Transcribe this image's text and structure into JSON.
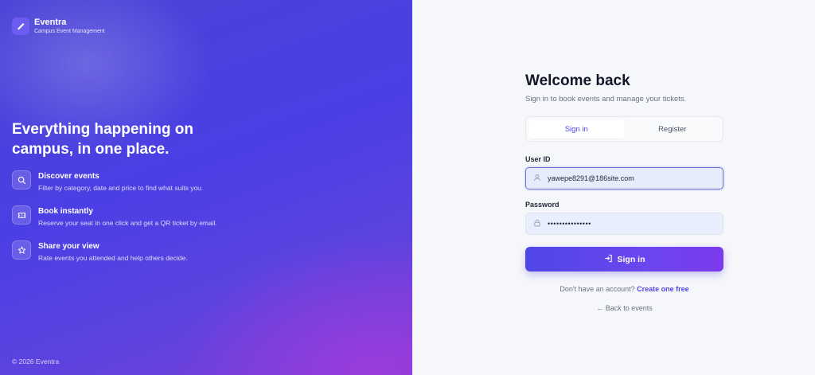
{
  "brand": {
    "name": "Eventra",
    "tagline": "Campus Event Management"
  },
  "hero": {
    "headline": "Everything happening on campus, in one place."
  },
  "features": [
    {
      "icon": "search-icon",
      "title": "Discover events",
      "description": "Filter by category, date and price to find what suits you."
    },
    {
      "icon": "ticket-icon",
      "title": "Book instantly",
      "description": "Reserve your seat in one click and get a QR ticket by email."
    },
    {
      "icon": "star-icon",
      "title": "Share your view",
      "description": "Rate events you attended and help others decide."
    }
  ],
  "footer": {
    "copyright": "© 2026 Eventra"
  },
  "form": {
    "title": "Welcome back",
    "subtitle": "Sign in to book events and manage your tickets.",
    "tabs": [
      {
        "label": "Sign in",
        "active": true
      },
      {
        "label": "Register",
        "active": false
      }
    ],
    "user_id_label": "User ID",
    "user_id_value": "yawepe8291@186site.com",
    "password_label": "Password",
    "password_value": "•••••••••••••••",
    "submit_label": "Sign in",
    "no_account_text": "Don't have an account?",
    "create_link": "Create one free",
    "back_link": "← Back to events"
  },
  "colors": {
    "accent": "#4f46e5",
    "panel_gradient_start": "#4a43d6",
    "panel_gradient_end": "#7a3ed8"
  }
}
